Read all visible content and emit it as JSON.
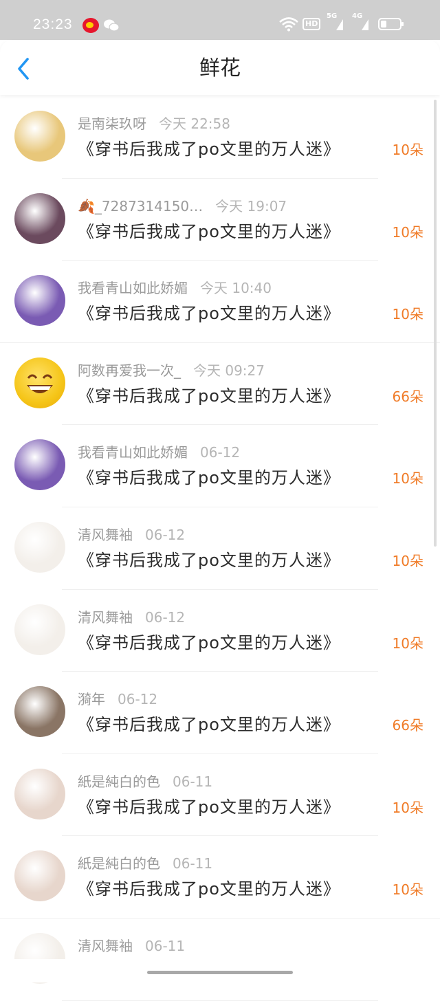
{
  "status_bar": {
    "time": "23:23",
    "hd_label": "HD",
    "net1_label": "5G",
    "net2_label": "4G"
  },
  "header": {
    "title": "鲜花"
  },
  "colors": {
    "accent": "#2196F3",
    "amount": "#F07B27",
    "meta_text": "#9A9A9A"
  },
  "rows": [
    {
      "user": "是南柒玖呀",
      "time": "今天 22:58",
      "book": "《穿书后我成了po文里的万人迷》",
      "amount": "10朵",
      "avatar_color": "#e8c77a"
    },
    {
      "user": "🍂_7287314150…",
      "time": "今天 19:07",
      "book": "《穿书后我成了po文里的万人迷》",
      "amount": "10朵",
      "avatar_color": "#6b4a5e"
    },
    {
      "user": "我看青山如此娇媚",
      "time": "今天 10:40",
      "book": "《穿书后我成了po文里的万人迷》",
      "amount": "10朵",
      "avatar_color": "#7a5bb3"
    },
    {
      "user": "阿数再爱我一次_",
      "time": "今天 09:27",
      "book": "《穿书后我成了po文里的万人迷》",
      "amount": "66朵",
      "avatar_color": "#f5c518"
    },
    {
      "user": "我看青山如此娇媚",
      "time": "06-12",
      "book": "《穿书后我成了po文里的万人迷》",
      "amount": "10朵",
      "avatar_color": "#7a5bb3"
    },
    {
      "user": "清风舞袖",
      "time": "06-12",
      "book": "《穿书后我成了po文里的万人迷》",
      "amount": "10朵",
      "avatar_color": "#f3efea"
    },
    {
      "user": "清风舞袖",
      "time": "06-12",
      "book": "《穿书后我成了po文里的万人迷》",
      "amount": "10朵",
      "avatar_color": "#f3efea"
    },
    {
      "user": "漪年",
      "time": "06-12",
      "book": "《穿书后我成了po文里的万人迷》",
      "amount": "66朵",
      "avatar_color": "#8a7565"
    },
    {
      "user": "紙是純白的色",
      "time": "06-11",
      "book": "《穿书后我成了po文里的万人迷》",
      "amount": "10朵",
      "avatar_color": "#e7d6cc"
    },
    {
      "user": "紙是純白的色",
      "time": "06-11",
      "book": "《穿书后我成了po文里的万人迷》",
      "amount": "10朵",
      "avatar_color": "#e7d6cc"
    },
    {
      "user": "清风舞袖",
      "time": "06-11",
      "book": "",
      "amount": "",
      "avatar_color": "#f3efea"
    }
  ]
}
